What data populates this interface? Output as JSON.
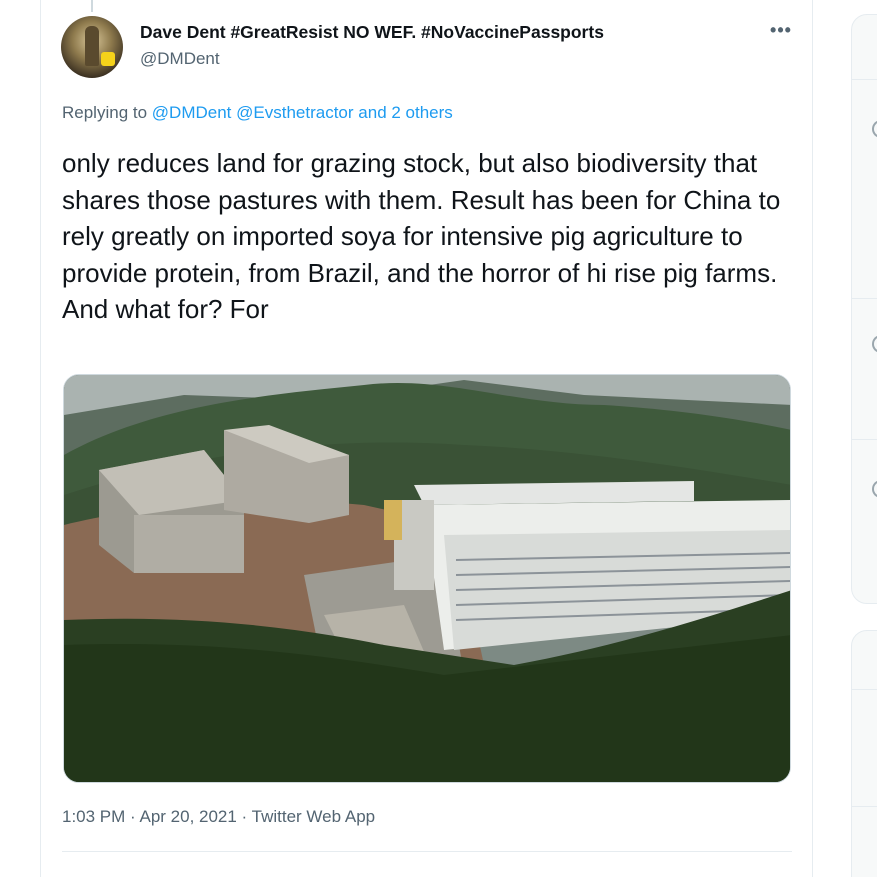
{
  "tweet": {
    "author": {
      "display_name": "Dave Dent #GreatResist NO WEF. #NoVaccinePassports",
      "handle": "@DMDent"
    },
    "more_icon": "more-horizontal-icon",
    "more_glyph": "•••",
    "reply_context": {
      "prefix": "Replying to",
      "mention_1": "@DMDent",
      "mention_2": "@Evsthetractor",
      "suffix": "and 2 others"
    },
    "text": "only reduces land for grazing stock, but also biodiversity that shares those pastures with them. Result has been for China to rely greatly on imported soya for intensive pig agriculture to provide protein, from Brazil, and the horror of hi rise pig farms. And what for? For",
    "meta": "1:03 PM · Apr 20, 2021 · Twitter Web App"
  },
  "colors": {
    "text_primary": "#0f1419",
    "text_secondary": "#536471",
    "link": "#1d9bf0",
    "border": "#e6ecf0"
  }
}
